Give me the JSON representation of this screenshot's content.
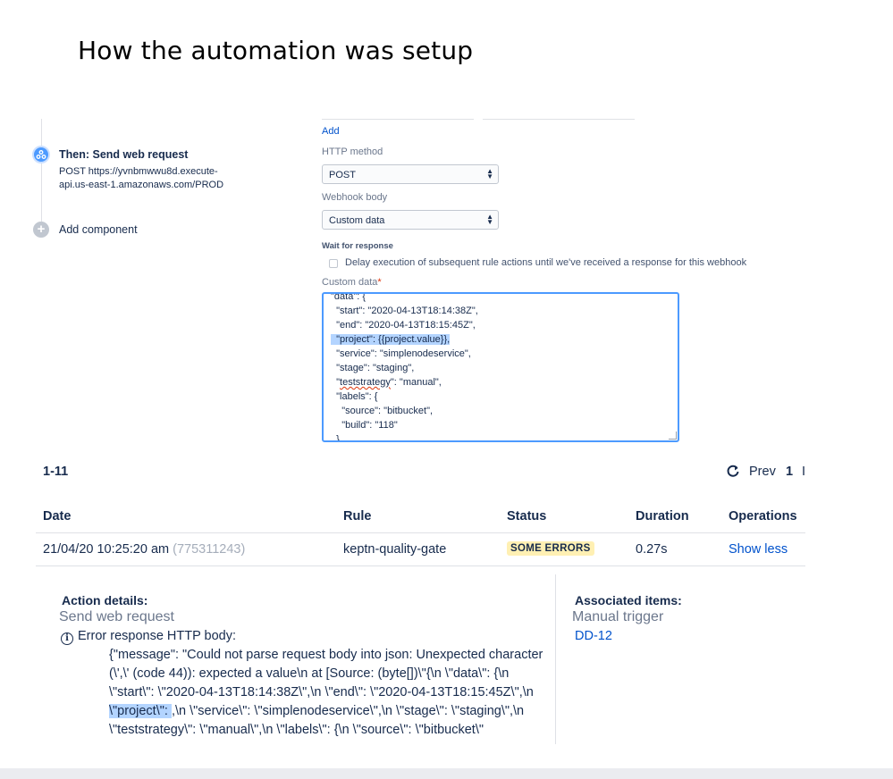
{
  "page_title": "How the automation was setup",
  "rule_chain": {
    "step_title": "Then: Send web request",
    "step_sub": "POST https://yvnbmwwu8d.execute-api.us-east-1.amazonaws.com/PROD",
    "add_component": "Add component"
  },
  "form": {
    "add_link": "Add",
    "http_method_label": "HTTP method",
    "http_method_value": "POST",
    "webhook_body_label": "Webhook body",
    "webhook_body_value": "Custom data",
    "wait_label": "Wait for response",
    "wait_checkbox_label": "Delay execution of subsequent rule actions until we've received a response for this webhook",
    "custom_data_label": "Custom data",
    "custom_data_required": "*",
    "code_lines": {
      "l1": "\"data\": {",
      "l2": "  \"start\": \"2020-04-13T18:14:38Z\",",
      "l3": "  \"end\": \"2020-04-13T18:15:45Z\",",
      "l4": "  \"project\": {{project.value}},",
      "l5": "  \"service\": \"simplenodeservice\",",
      "l6": "  \"stage\": \"staging\",",
      "l7a": "  \"",
      "l7b": "teststrategy",
      "l7c": "\": \"manual\",",
      "l8": "  \"labels\": {",
      "l9": "    \"source\": \"bitbucket\",",
      "l10": "    \"build\": \"118\"",
      "l11": "  }"
    }
  },
  "audit": {
    "range": "1-11",
    "prev_label": "Prev",
    "current_page": "1",
    "next_partial": "I",
    "columns": [
      "Date",
      "Rule",
      "Status",
      "Duration",
      "Operations"
    ],
    "row": {
      "date": "21/04/20 10:25:20 am",
      "id": "(775311243)",
      "rule": "keptn-quality-gate",
      "status": "SOME ERRORS",
      "duration": "0.27s",
      "operation": "Show less"
    }
  },
  "details": {
    "action_heading": "Action details:",
    "action_name": "Send web request",
    "error_title": "Error response HTTP body:",
    "error_body_pre": "{\"message\": \"Could not parse request body into json: Unexpected character (\\',\\' (code 44)): expected a value\\n at [Source: (byte[])\\\"{\\n \\\"data\\\": {\\n \\\"start\\\": \\\"2020-04-13T18:14:38Z\\\",\\n \\\"end\\\": \\\"2020-04-13T18:15:45Z\\\",\\n ",
    "error_body_highlight": "\\\"project\\\": ",
    "error_body_post": ",\\n \\\"service\\\": \\\"simplenodeservice\\\",\\n \\\"stage\\\": \\\"staging\\\",\\n \\\"teststrategy\\\": \\\"manual\\\",\\n \\\"labels\\\": {\\n \\\"source\\\": \\\"bitbucket\\\"",
    "associated_heading": "Associated items:",
    "trigger": "Manual trigger",
    "issue_link": "DD-12"
  },
  "colors": {
    "accent": "#0052cc",
    "focus_border": "#4c9aff",
    "highlight": "#b3d4ff",
    "badge_bg": "#fff0b3"
  },
  "icons": [
    "webhook-icon",
    "add-icon",
    "refresh-icon",
    "info-icon",
    "select-arrows-icon"
  ]
}
